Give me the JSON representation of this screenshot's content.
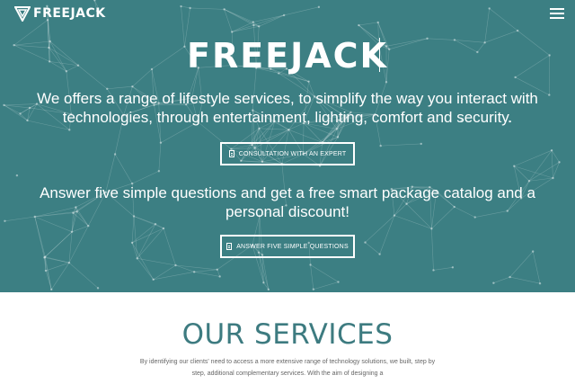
{
  "brand": {
    "name": "FREEJACK",
    "colors": {
      "hero_bg": "#3c7f83",
      "accent": "#3d7b80",
      "text_light": "#ffffff"
    }
  },
  "header": {
    "logo_text": "FREEJACK",
    "menu_icon": "hamburger-menu-icon"
  },
  "hero": {
    "title": "FREEJACK",
    "lead": "We offers a range of lifestyle services, to simplify the way you interact with technologies, through entertainment, lighting, comfort and security.",
    "cta_primary": {
      "label": "CONSULTATION WITH AN EXPERT",
      "icon": "document-icon"
    },
    "sub": "Answer five simple questions and get a free smart package catalog and a personal discount!",
    "cta_secondary": {
      "label": "ANSWER FIVE SIMPLE QUESTIONS",
      "icon": "document-icon"
    }
  },
  "services": {
    "title": "OUR SERVICES",
    "intro": "By identifying our clients' need to access a more extensive range of technology solutions, we built, step by step, additional complementary services. With the aim of designing a"
  }
}
